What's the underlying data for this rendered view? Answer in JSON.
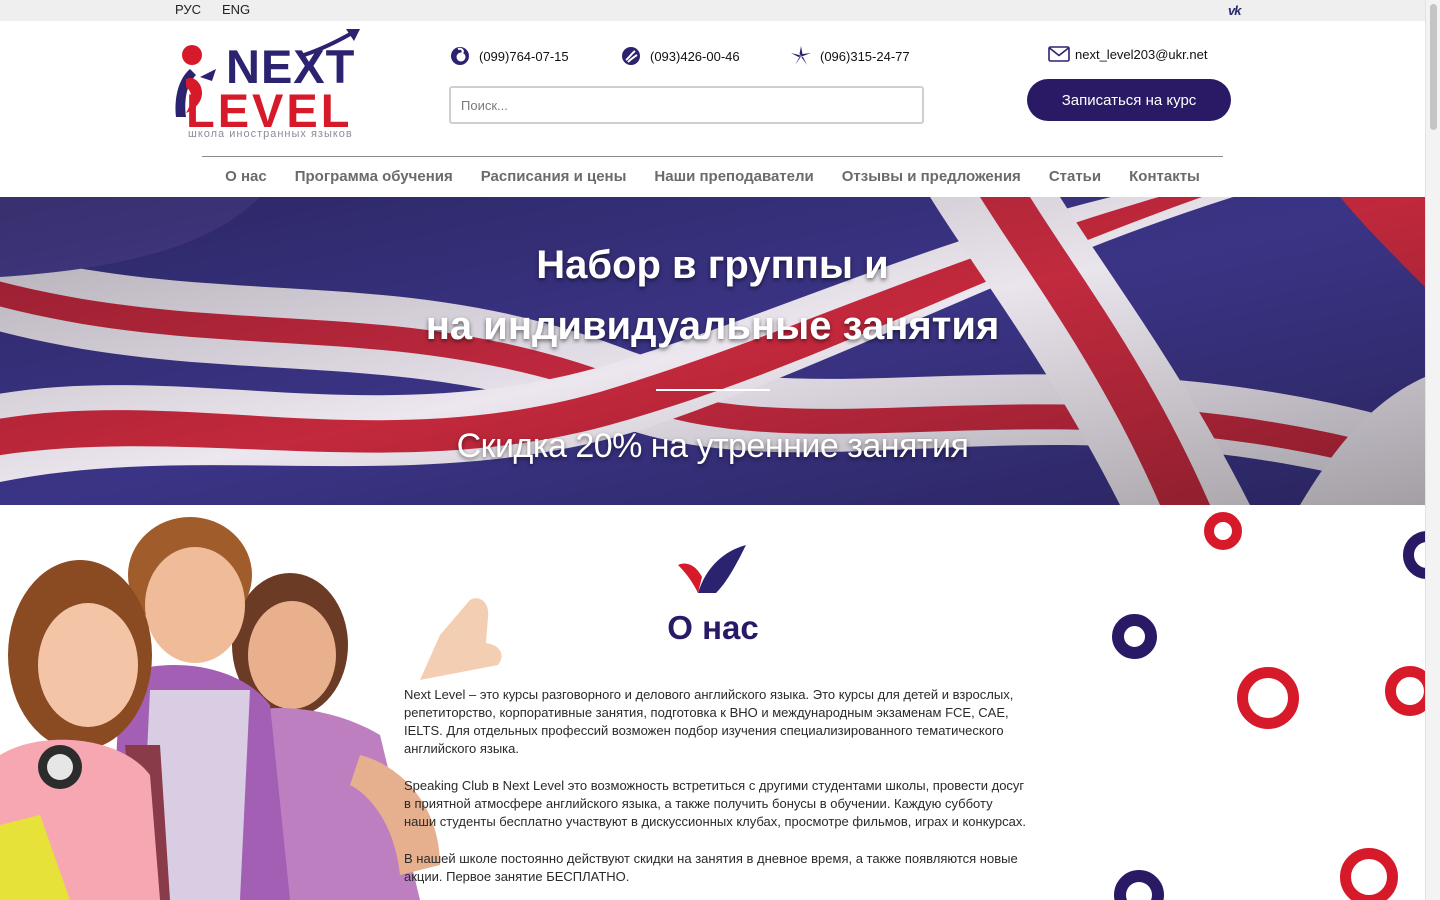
{
  "topbar": {
    "lang_ru": "РУС",
    "lang_en": "ENG",
    "social_icon": "vk-icon",
    "social_text": "vk"
  },
  "brand": {
    "logo_top": "NEXT",
    "logo_bottom": "LEVEL",
    "logo_tagline": "школа иностранных языков",
    "primary_color": "#2a1a66",
    "accent_color": "#d71a2a"
  },
  "contacts": {
    "phones": [
      {
        "number": "(099)764-07-15",
        "icon": "vodafone-icon"
      },
      {
        "number": "(093)426-00-46",
        "icon": "lifecell-icon"
      },
      {
        "number": "(096)315-24-77",
        "icon": "kyivstar-icon"
      }
    ],
    "email": "next_level203@ukr.net",
    "email_icon": "envelope-icon"
  },
  "search": {
    "placeholder": "Поиск...",
    "value": ""
  },
  "cta_label": "Записаться на курс",
  "nav": [
    "О нас",
    "Программа обучения",
    "Расписания и цены",
    "Наши преподаватели",
    "Отзывы и предложения",
    "Статьи",
    "Контакты"
  ],
  "hero": {
    "title_line1": "Набор в группы и",
    "title_line2": "на индивидуальные занятия",
    "subtitle": "Скидка 20% на утренние занятия"
  },
  "about": {
    "title": "О нас",
    "paragraphs": [
      "Next Level – это курсы разговорного и делового английского языка. Это курсы для детей и взрослых, репетиторство, корпоративные занятия, подготовка к ВНО и международным экзаменам FCE, CAE, IELTS. Для отдельных профессий возможен подбор изучения специализированного тематического английского языка.",
      "Speaking Club в Next Level это возможность встретиться с другими студентами школы, провести досуг в приятной атмосфере английского языка, а также получить бонусы в обучении. Каждую субботу наши студенты бесплатно участвуют в дискуссионных клубах, просмотре фильмов, играх и конкурсах.",
      "В нашей школе постоянно действуют скидки на занятия в дневное время, а также появляются новые акции. Первое занятие БЕСПЛАТНО."
    ]
  }
}
